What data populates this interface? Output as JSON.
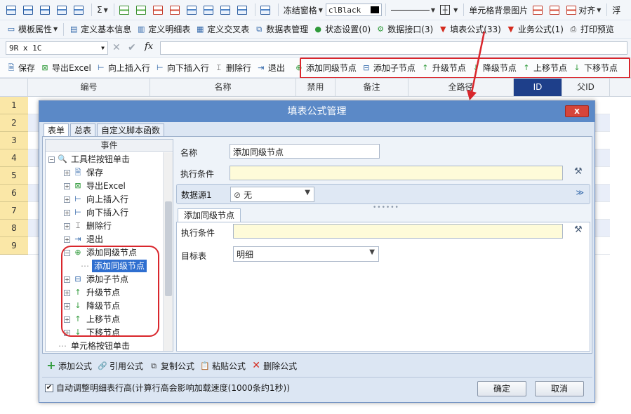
{
  "toolbar1": {
    "sigma": "Σ",
    "freeze_label": "冻结窗格",
    "color_value": "clBlack",
    "cell_bg_label": "单元格背景图片",
    "align_label": "对齐",
    "float_label": "浮"
  },
  "toolbar2": {
    "items": [
      "模板属性",
      "定义基本信息",
      "定义明细表",
      "定义交叉表",
      "数据表管理",
      "状态设置(0)",
      "数据接口(3)",
      "填表公式(33)",
      "业务公式(1)",
      "打印预览"
    ]
  },
  "formula_bar": {
    "name_box": "9R x 1C",
    "fx": "fx"
  },
  "toolbar3": {
    "left": [
      "保存",
      "导出Excel",
      "向上插入行",
      "向下插入行",
      "删除行",
      "退出"
    ],
    "right": [
      "添加同级节点",
      "添加子节点",
      "升级节点",
      "降级节点",
      "上移节点",
      "下移节点"
    ]
  },
  "sheet": {
    "columns": [
      "编号",
      "名称",
      "禁用",
      "备注",
      "全路径",
      "ID",
      "父ID"
    ],
    "rows": [
      "1",
      "2",
      "3",
      "4",
      "5",
      "6",
      "7",
      "8",
      "9"
    ]
  },
  "dialog": {
    "title": "填表公式管理",
    "close": "x",
    "tabs": [
      "表单",
      "总表",
      "自定义脚本函数"
    ],
    "tree": {
      "header": "事件",
      "root": "工具栏按钮单击",
      "children": [
        "保存",
        "导出Excel",
        "向上插入行",
        "向下插入行",
        "删除行",
        "退出",
        "添加同级节点",
        "添加子节点",
        "升级节点",
        "降级节点",
        "上移节点",
        "下移节点"
      ],
      "selected_child": "添加同级节点",
      "last": "单元格按钮单击"
    },
    "form": {
      "name_label": "名称",
      "name_value": "添加同级节点",
      "cond_label": "执行条件",
      "ds_label": "数据源1",
      "ds_value": "无",
      "section_title": "添加同级节点",
      "cond2_label": "执行条件",
      "target_label": "目标表",
      "target_value": "明细"
    },
    "actions": [
      "添加公式",
      "引用公式",
      "复制公式",
      "粘贴公式",
      "删除公式"
    ],
    "auto_adjust": "自动调整明细表行高(计算行高会影响加载速度(1000条约1秒))",
    "ok": "确定",
    "cancel": "取消"
  }
}
